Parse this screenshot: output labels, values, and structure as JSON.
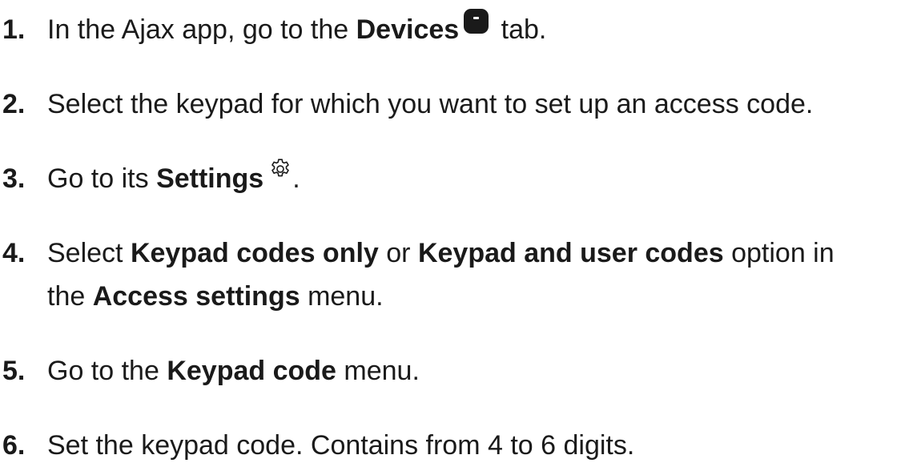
{
  "steps": [
    {
      "number": "1.",
      "t1": "In the Ajax app, go to the ",
      "b1": "Devices",
      "t2": " tab.",
      "icon": "devices-tab-icon"
    },
    {
      "number": "2.",
      "t1": "Select the keypad for which you want to set up an access code."
    },
    {
      "number": "3.",
      "t1": "Go to its ",
      "b1": "Settings",
      "t2": ".",
      "icon": "gear-icon"
    },
    {
      "number": "4.",
      "t1": "Select ",
      "b1": "Keypad codes only",
      "t2": " or ",
      "b2": "Keypad and user codes",
      "t3": " option in",
      "t4": "the ",
      "b3": "Access settings",
      "t5": " menu."
    },
    {
      "number": "5.",
      "t1": "Go to the ",
      "b1": "Keypad code",
      "t2": " menu."
    },
    {
      "number": "6.",
      "t1": "Set the keypad code. Contains from 4 to 6 digits."
    }
  ]
}
